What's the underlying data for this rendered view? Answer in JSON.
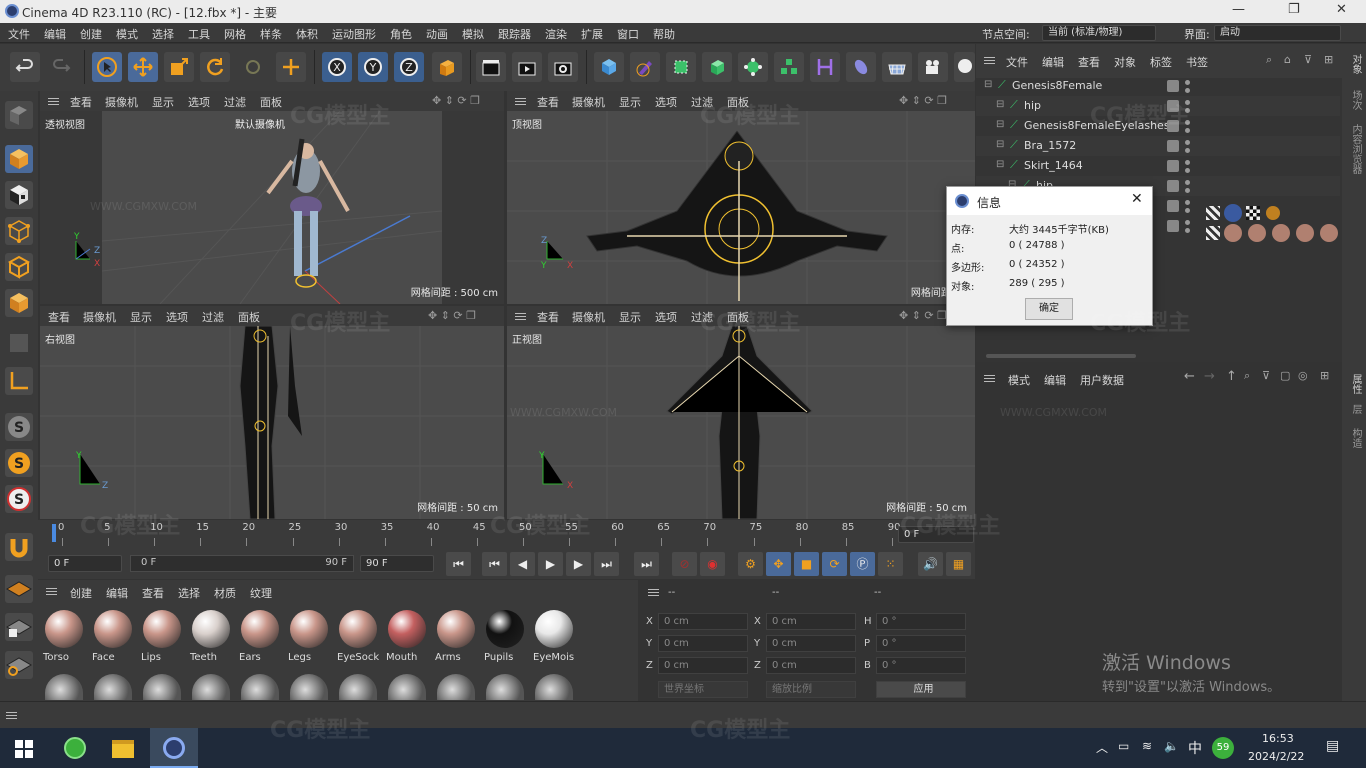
{
  "window": {
    "title": "Cinema 4D R23.110 (RC) - [12.fbx *] - 主要",
    "min": "—",
    "max": "❐",
    "close": "✕"
  },
  "menu": {
    "items": [
      "文件",
      "编辑",
      "创建",
      "模式",
      "选择",
      "工具",
      "网格",
      "样条",
      "体积",
      "运动图形",
      "角色",
      "动画",
      "模拟",
      "跟踪器",
      "渲染",
      "扩展",
      "窗口",
      "帮助"
    ],
    "node_space_label": "节点空间:",
    "node_space_value": "当前 (标准/物理)",
    "layout_label": "界面:",
    "layout_value": "启动"
  },
  "viewports": [
    {
      "menu": [
        "查看",
        "摄像机",
        "显示",
        "选项",
        "过滤",
        "面板"
      ],
      "label": "透视视图",
      "camera": "默认摄像机",
      "grid": "网格间距 : 500 cm"
    },
    {
      "menu": [
        "查看",
        "摄像机",
        "显示",
        "选项",
        "过滤",
        "面板"
      ],
      "label": "顶视图",
      "grid": "网格间距 : 5"
    },
    {
      "menu": [
        "查看",
        "摄像机",
        "显示",
        "选项",
        "过滤",
        "面板"
      ],
      "label": "右视图",
      "grid": "网格间距 : 50 cm"
    },
    {
      "menu": [
        "查看",
        "摄像机",
        "显示",
        "选项",
        "过滤",
        "面板"
      ],
      "label": "正视图",
      "grid": "网格间距 : 50 cm"
    }
  ],
  "timeline": {
    "ticks": [
      "0",
      "5",
      "10",
      "15",
      "20",
      "25",
      "30",
      "35",
      "40",
      "45",
      "50",
      "55",
      "60",
      "65",
      "70",
      "75",
      "80",
      "85",
      "90"
    ],
    "current": "0 F"
  },
  "transport": {
    "start": "0 F",
    "range_start": "0 F",
    "range_end": "90 F",
    "end": "90 F"
  },
  "materials": {
    "menu": [
      "创建",
      "编辑",
      "查看",
      "选择",
      "材质",
      "纹理"
    ],
    "items": [
      {
        "name": "Torso",
        "color": "#c9968a"
      },
      {
        "name": "Face",
        "color": "#c9968a"
      },
      {
        "name": "Lips",
        "color": "#c9968a"
      },
      {
        "name": "Teeth",
        "color": "#d9d0cc"
      },
      {
        "name": "Ears",
        "color": "#c9968a"
      },
      {
        "name": "Legs",
        "color": "#c9968a"
      },
      {
        "name": "EyeSock",
        "color": "#c9968a"
      },
      {
        "name": "Mouth",
        "color": "#c46060"
      },
      {
        "name": "Arms",
        "color": "#c9968a"
      },
      {
        "name": "Pupils",
        "color": "#111111"
      },
      {
        "name": "EyeMois",
        "color": "#e8e8e8"
      }
    ]
  },
  "coords": {
    "headers": [
      "--",
      "--",
      "--"
    ],
    "rows": [
      {
        "a": "X",
        "av": "0 cm",
        "b": "X",
        "bv": "0 cm",
        "c": "H",
        "cv": "0 °"
      },
      {
        "a": "Y",
        "av": "0 cm",
        "b": "Y",
        "bv": "0 cm",
        "c": "P",
        "cv": "0 °"
      },
      {
        "a": "Z",
        "av": "0 cm",
        "b": "Z",
        "bv": "0 cm",
        "c": "B",
        "cv": "0 °"
      }
    ],
    "world": "世界坐标",
    "scale": "缩放比例",
    "apply": "应用"
  },
  "objects": {
    "menu": [
      "文件",
      "编辑",
      "查看",
      "对象",
      "标签",
      "书签"
    ],
    "items": [
      {
        "name": "Genesis8Female",
        "indent": 0
      },
      {
        "name": "hip",
        "indent": 1
      },
      {
        "name": "Genesis8FemaleEyelashes",
        "indent": 1
      },
      {
        "name": "Bra_1572",
        "indent": 1
      },
      {
        "name": "Skirt_1464",
        "indent": 1
      },
      {
        "name": "hip",
        "indent": 2
      }
    ]
  },
  "attributes": {
    "menu": [
      "模式",
      "编辑",
      "用户数据"
    ]
  },
  "right_tabs": {
    "top": [
      "对象",
      "场次",
      "内容浏览器"
    ],
    "bottom": [
      "属性",
      "层",
      "构造"
    ]
  },
  "info": {
    "title": "信息",
    "rows": [
      {
        "label": "内存:",
        "value": "大约 3445千字节(KB)"
      },
      {
        "label": "点:",
        "value": "0 ( 24788 )"
      },
      {
        "label": "多边形:",
        "value": "0 ( 24352 )"
      },
      {
        "label": "对象:",
        "value": "289 ( 295 )"
      }
    ],
    "ok": "确定"
  },
  "activation": {
    "line1": "激活 Windows",
    "line2": "转到\"设置\"以激活 Windows。"
  },
  "taskbar": {
    "time": "16:53",
    "date": "2024/2/22",
    "ime": "中",
    "badge": "59"
  },
  "watermark": {
    "brand": "CG模型主",
    "url": "WWW.CGMXW.COM"
  },
  "colors": {
    "accent": "#4a6a9a",
    "viewport": "#4b4b4b",
    "panel": "#3a3a3a"
  }
}
